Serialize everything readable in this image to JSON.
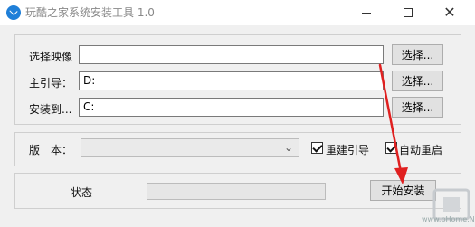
{
  "window": {
    "title": "玩酷之家系统安装工具 1.0",
    "minimize": "—",
    "maximize": "☐",
    "close": "✕"
  },
  "source": {
    "image_label": "选择映像",
    "image_value": "",
    "image_browse": "选择...",
    "boot_label": "主引导：",
    "boot_value": "D:",
    "boot_browse": "选择...",
    "install_label": "安装到...",
    "install_value": "C:",
    "install_browse": "选择..."
  },
  "options": {
    "version_label": "版　本：",
    "version_value": "",
    "rebuild_boot_label": "重建引导",
    "rebuild_boot_checked": true,
    "auto_restart_label": "自动重启",
    "auto_restart_checked": true
  },
  "status": {
    "label": "状态",
    "progress_fraction": 0,
    "start_button": "开始安装"
  },
  "watermark": {
    "text": "www.pHome.NET"
  },
  "colors": {
    "accent_icon": "#1f7fd8",
    "arrow": "#e02020"
  },
  "icons": {
    "app": "download-arrow-icon",
    "dropdown": "chevron-down-icon",
    "annotation": "red-arrow"
  }
}
